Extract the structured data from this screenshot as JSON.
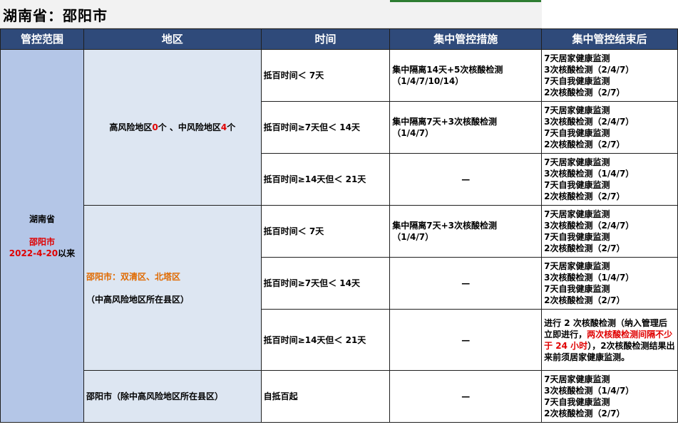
{
  "title": "湖南省：邵阳市",
  "headers": [
    "管控范围",
    "地区",
    "时间",
    "集中管控措施",
    "集中管控结束后"
  ],
  "scope": {
    "province": "湖南省",
    "city": "邵阳市",
    "date": "2022-4-20",
    "since": "以来"
  },
  "area1": {
    "p1": "高风险地区",
    "n1": "0",
    "p2": "个 、中风险地区",
    "n2": "4",
    "p3": "个"
  },
  "area2": {
    "name": "邵阳市：双清区、北塔区",
    "note": "（中高风险地区所在县区）"
  },
  "area3": {
    "name": "邵阳市（除中高风险地区所在县区）"
  },
  "rows": [
    {
      "time": "抵百时间＜ 7天",
      "measure": [
        "集中隔离14天+5次核酸检测",
        "（1/4/7/10/14）"
      ],
      "after": [
        "7天居家健康监测",
        "3次核酸检测（2/4/7）",
        "7天自我健康监测",
        "2次核酸检测（2/7）"
      ]
    },
    {
      "time": "抵百时间≥7天但＜ 14天",
      "measure": [
        "集中隔离7天+3次核酸检测",
        "（1/4/7）"
      ],
      "after": [
        "7天居家健康监测",
        "3次核酸检测（2/4/7）",
        "7天自我健康监测",
        "2次核酸检测（2/7）"
      ]
    },
    {
      "time": "抵百时间≥14天但＜ 21天",
      "measure": [
        "—"
      ],
      "after": [
        "7天居家健康监测",
        "3次核酸检测（1/4/7）",
        "7天自我健康监测",
        "2次核酸检测（2/7）"
      ]
    },
    {
      "time": "抵百时间＜ 7天",
      "measure": [
        "集中隔离7天+3次核酸检测",
        "（1/4/7）"
      ],
      "after": [
        "7天居家健康监测",
        "3次核酸检测（2/4/7）",
        "7天自我健康监测",
        "2次核酸检测（2/7）"
      ]
    },
    {
      "time": "抵百时间≥7天但＜ 14天",
      "measure": [
        "—"
      ],
      "after": [
        "7天居家健康监测",
        "3次核酸检测（1/4/7）",
        "7天自我健康监测",
        "2次核酸检测（2/7）"
      ]
    },
    {
      "time": "抵百时间≥14天但＜ 21天",
      "measure": [
        "—"
      ],
      "after_special": {
        "a": "进行 2 次核酸检测（纳入管理后立即进行，",
        "b": "两次核酸检测间隔不少于 24 小时",
        "c": "），2次核酸检测结果出来前须居家健康监测。"
      }
    },
    {
      "time": "自抵百起",
      "measure": [
        "—"
      ],
      "after": [
        "7天居家健康监测",
        "3次核酸检测（1/4/7）",
        "7天自我健康监测",
        "2次核酸检测（2/7）"
      ]
    }
  ],
  "colors": {
    "header_bg": "#2f4a7a",
    "scope_bg": "#b4c6e7",
    "area_bg": "#dde6f2",
    "highlight_red": "#e00000",
    "highlight_orange": "#e06a00"
  }
}
